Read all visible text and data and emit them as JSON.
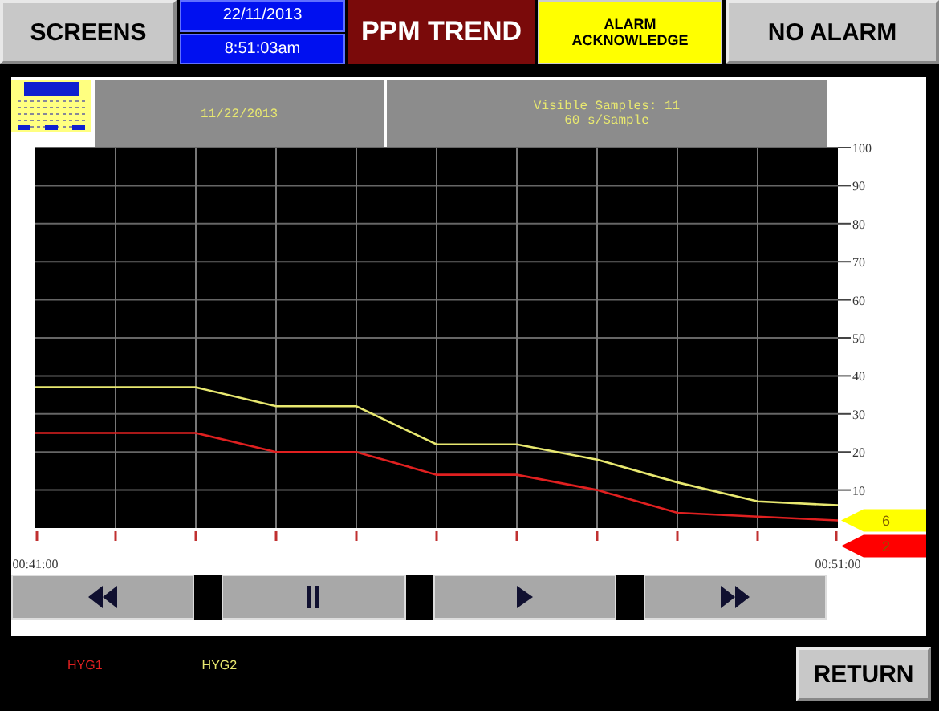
{
  "top_bar": {
    "screens_button": "SCREENS",
    "date": "22/11/2013",
    "time": "8:51:03am",
    "title": "PPM TREND",
    "acknowledge_button": "ALARM ACKNOWLEDGE",
    "alarm_status": "NO ALARM"
  },
  "trend": {
    "date": "11/22/2013",
    "samples_info": [
      "Visible Samples: 11",
      "60 s/Sample"
    ],
    "chart_data": {
      "type": "line",
      "x": [
        41,
        42,
        43,
        44,
        45,
        46,
        47,
        48,
        49,
        50,
        51
      ],
      "xlim": [
        41,
        51
      ],
      "xticks": [
        {
          "value": 41,
          "label": "00:41:00"
        },
        {
          "value": 51,
          "label": "00:51:00"
        }
      ],
      "ylim": [
        0,
        100
      ],
      "grid": true,
      "yticks": [
        10,
        20,
        30,
        40,
        50,
        60,
        70,
        80,
        90,
        100
      ],
      "series": [
        {
          "name": "HYG1",
          "color": "#e02020",
          "values": [
            25,
            25,
            25,
            20,
            20,
            14,
            14,
            10,
            4,
            3,
            2
          ]
        },
        {
          "name": "HYG2",
          "color": "#e8e870",
          "values": [
            37,
            37,
            37,
            32,
            32,
            22,
            22,
            18,
            12,
            7,
            6
          ]
        }
      ]
    },
    "value_flags": [
      {
        "label": "6",
        "color": "#ffff00"
      },
      {
        "label": "2",
        "color": "#ff0000"
      }
    ],
    "controls": [
      {
        "kind": "rewind"
      },
      {
        "kind": "pause"
      },
      {
        "kind": "play"
      },
      {
        "kind": "fast_forward"
      }
    ]
  },
  "return_button": "RETURN"
}
